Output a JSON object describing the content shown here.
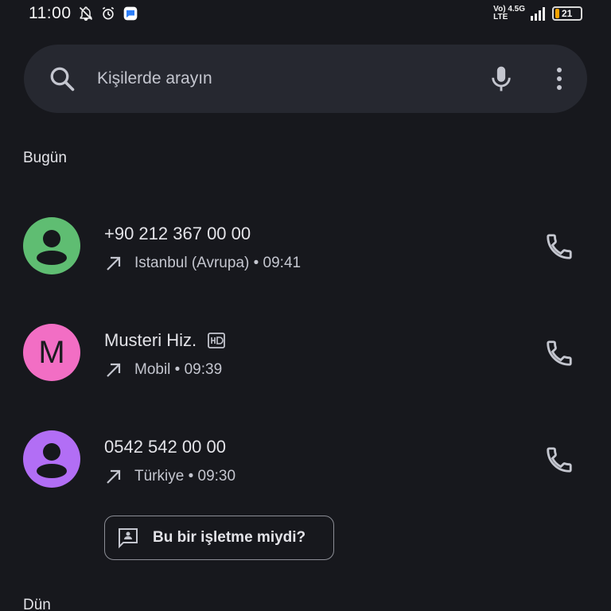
{
  "status": {
    "time": "11:00",
    "network_top": "Vo) 4.5G",
    "network_bottom": "LTE",
    "battery": "21"
  },
  "search": {
    "placeholder": "Kişilerde arayın",
    "icons": [
      "search-icon",
      "mic-icon",
      "more-vert-icon"
    ]
  },
  "sections": {
    "today": "Bugün",
    "yesterday": "Dün"
  },
  "calls": [
    {
      "name": "+90 212 367 00 00",
      "detail": "Istanbul (Avrupa) • 09:41",
      "avatar_type": "person",
      "avatar_letter": "",
      "avatar_color": "#5fbd72",
      "hd": false
    },
    {
      "name": "Musteri Hiz.",
      "detail": "Mobil • 09:39",
      "avatar_type": "letter",
      "avatar_letter": "M",
      "avatar_color": "#f26ec4",
      "hd": true
    },
    {
      "name": "0542 542 00 00",
      "detail": "Türkiye • 09:30",
      "avatar_type": "person",
      "avatar_letter": "",
      "avatar_color": "#b26ef5",
      "hd": false
    }
  ],
  "business_prompt": {
    "label": "Bu bir işletme miydi?"
  },
  "colors": {
    "background": "#17181d",
    "search_bg": "#262830",
    "battery_accent": "#f4a300"
  }
}
